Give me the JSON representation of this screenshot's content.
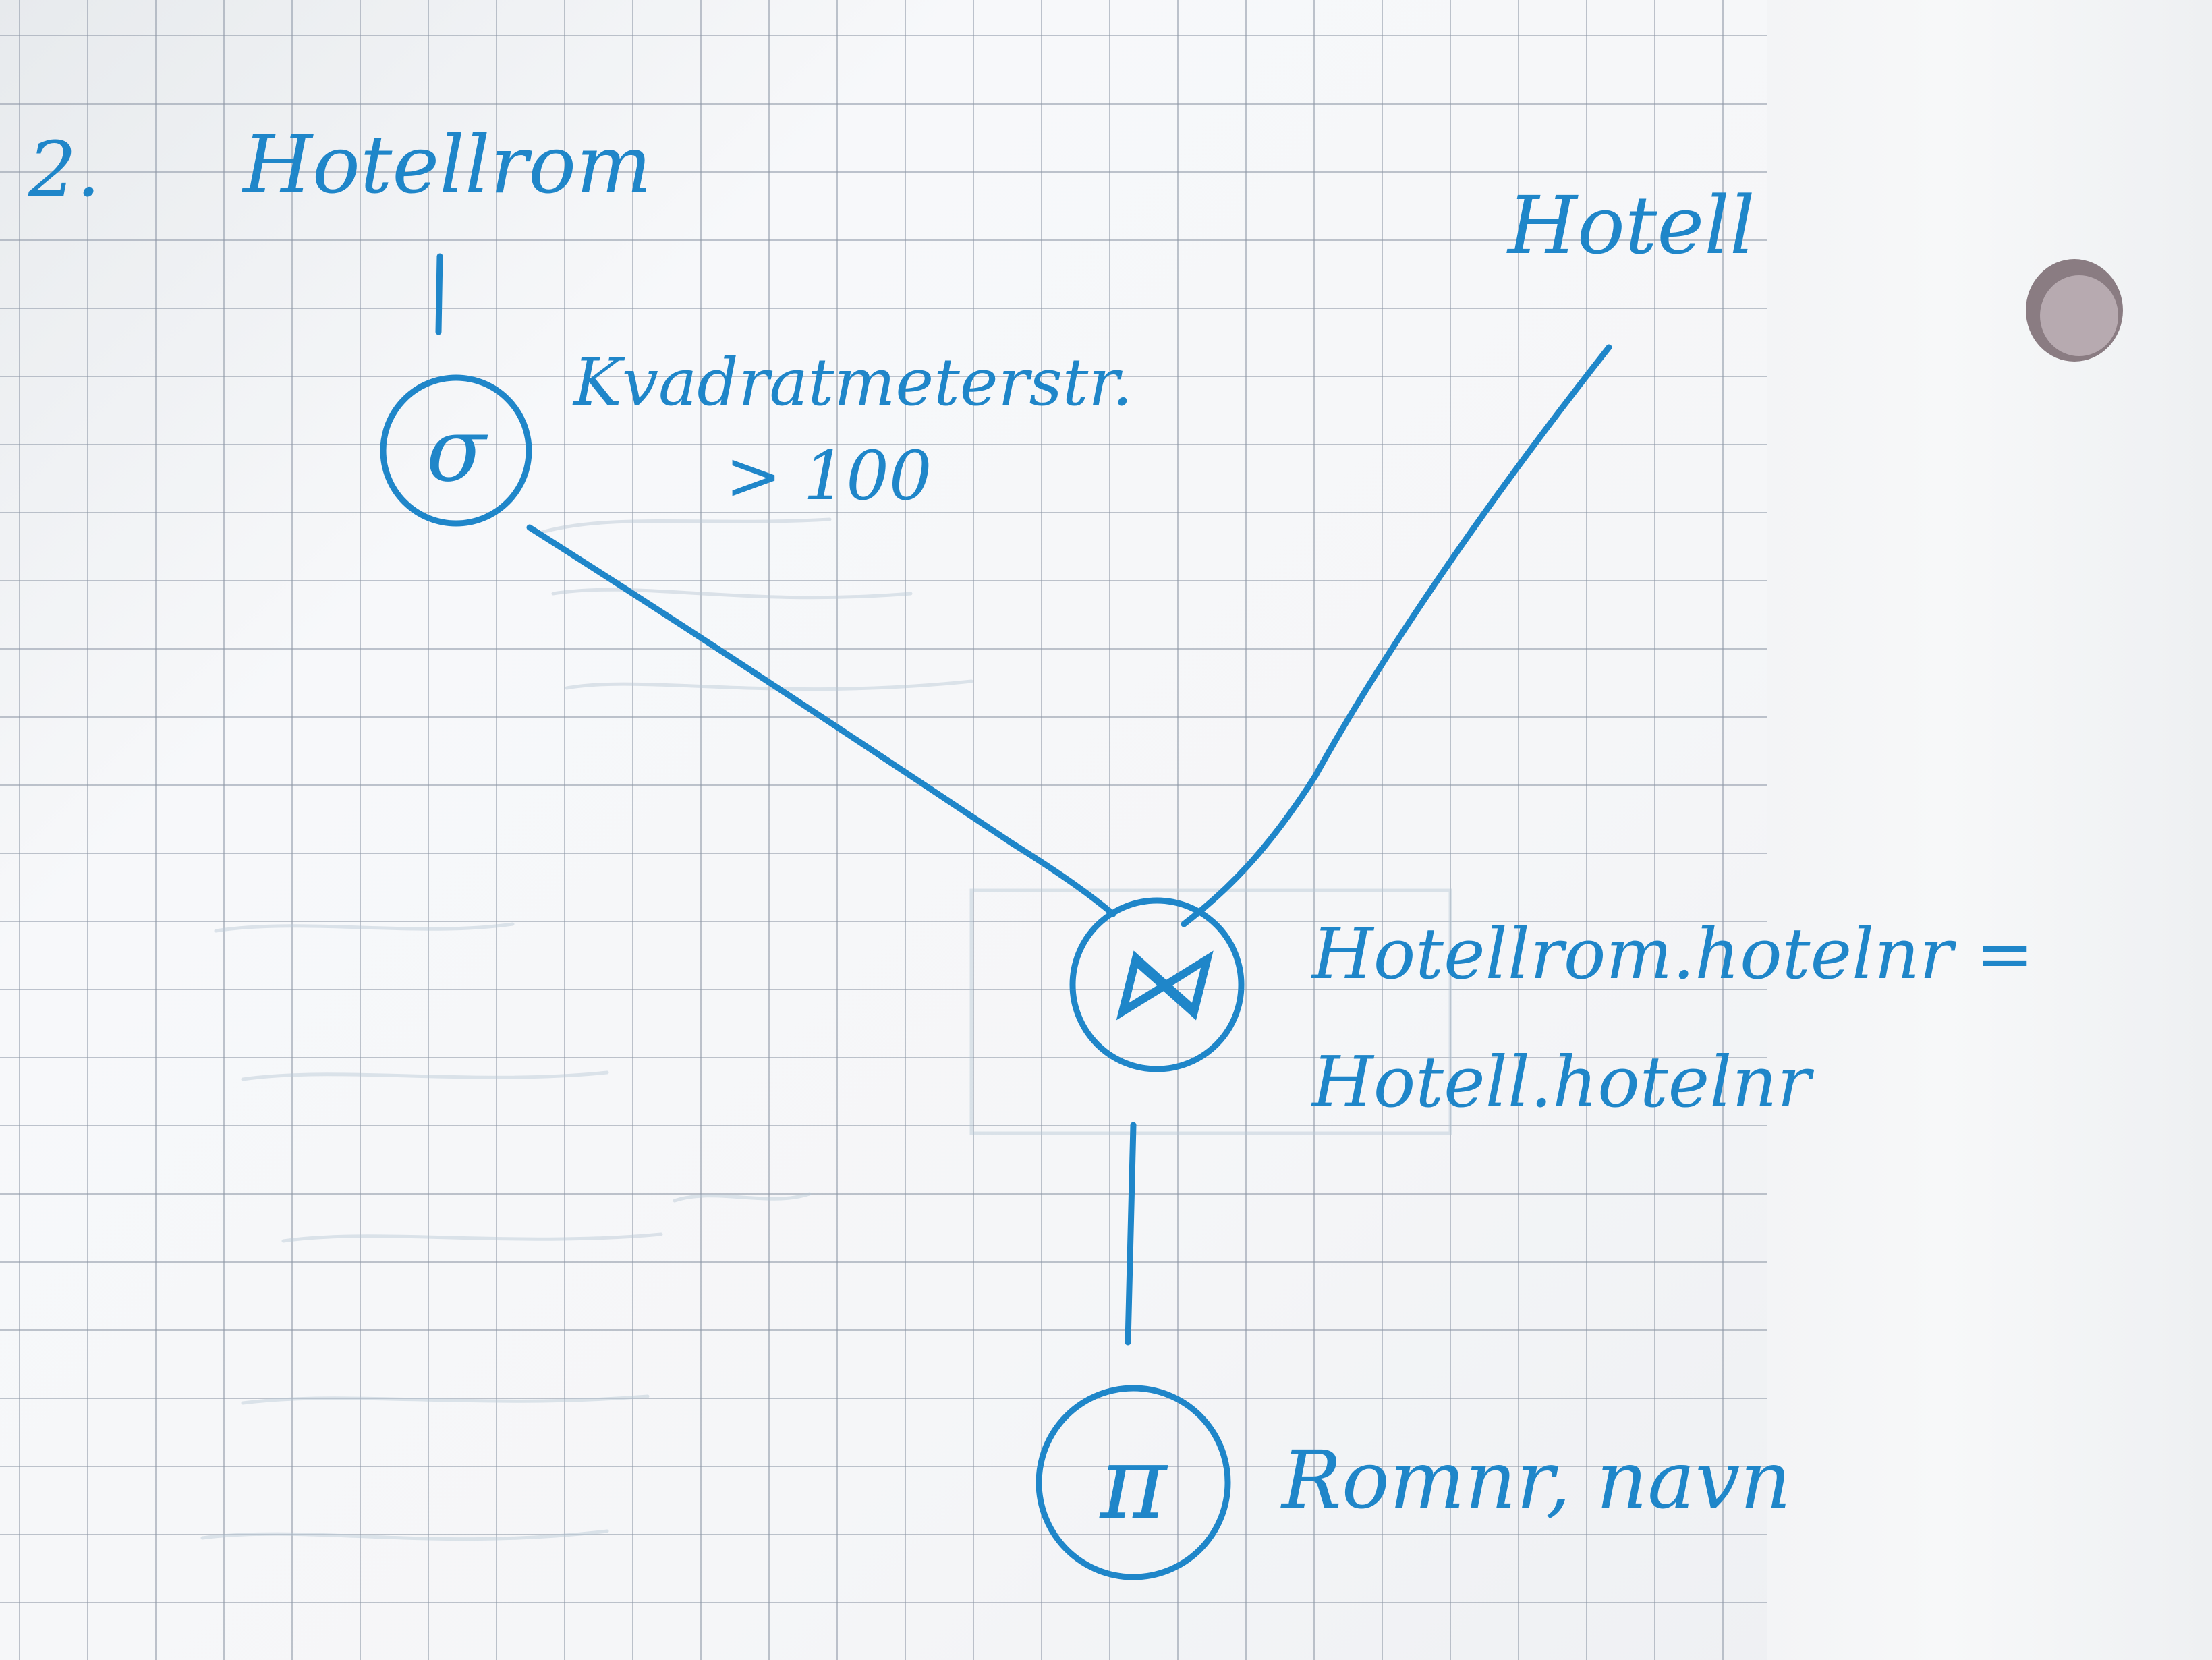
{
  "heading": {
    "number": "2.",
    "title": "Hotellrom"
  },
  "relations": {
    "hotel": "Hotell"
  },
  "nodes": {
    "selection": {
      "symbol": "σ",
      "condition_line1": "Kvadratmeterstr.",
      "condition_line2": "> 100"
    },
    "join": {
      "symbol": "⋈",
      "condition_line1": "Hotellrom.hotelnr =",
      "condition_line2": "Hotell.hotelnr"
    },
    "projection": {
      "symbol": "π",
      "attributes": "Romnr, navn"
    }
  },
  "colors": {
    "ink": "#1f86c9",
    "paper": "#f5f6f8",
    "grid": "#8c96a5"
  }
}
